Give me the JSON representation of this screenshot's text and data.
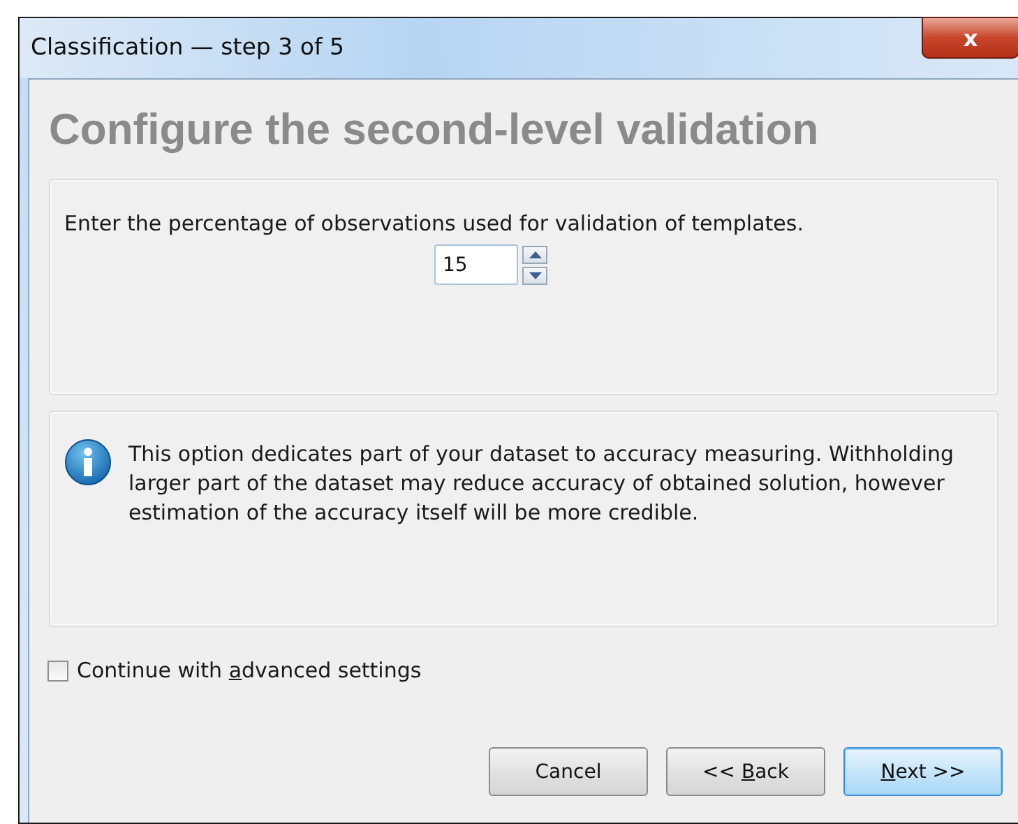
{
  "window": {
    "title": "Classification — step 3 of 5",
    "close": "x"
  },
  "heading": "Configure the second-level validation",
  "validation": {
    "prompt": "Enter the percentage of observations used for validation of templates.",
    "value": "15"
  },
  "info": {
    "text": "This option dedicates part of your dataset to accuracy measuring. Withholding larger part of the dataset may reduce accuracy of obtained solution, however estimation of the accuracy itself will be more credible."
  },
  "advanced": {
    "label": {
      "before": "Continue with ",
      "key": "a",
      "after": "dvanced settings"
    },
    "checked": false
  },
  "buttons": [
    {
      "label": {
        "before": "Cancel"
      },
      "default": false
    },
    {
      "label": {
        "before": "<< ",
        "key": "B",
        "after": "ack"
      },
      "default": false
    },
    {
      "label": {
        "key": "N",
        "after": "ext >>"
      },
      "default": true
    }
  ]
}
